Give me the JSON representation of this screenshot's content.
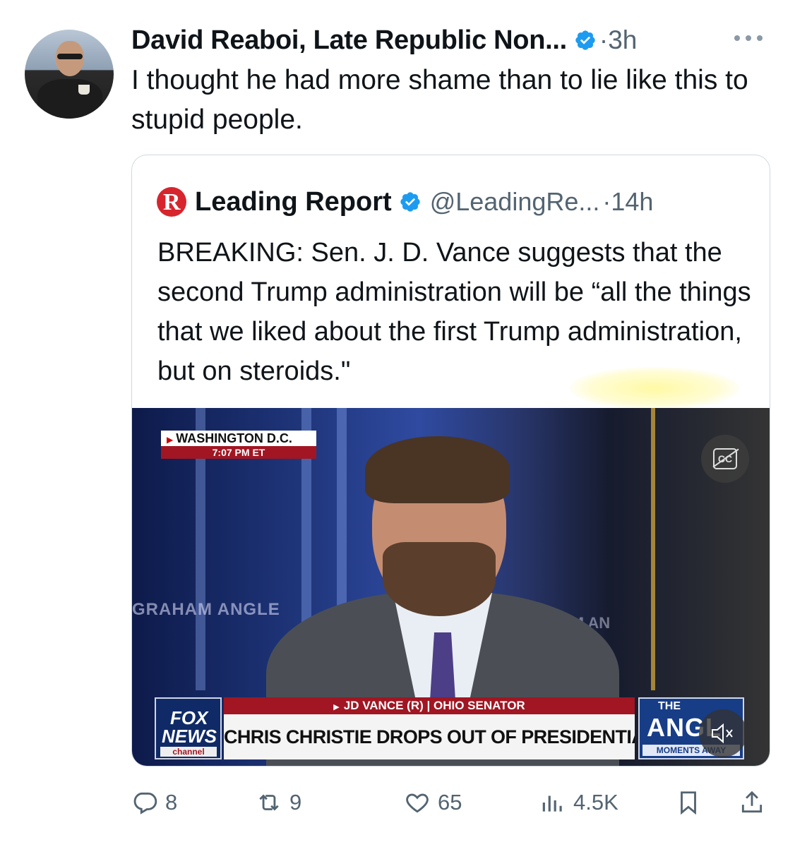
{
  "author": {
    "name": "David Reaboi, Late Republic Non...",
    "verified": true,
    "time": "·3h"
  },
  "tweet": {
    "text": "I thought he had more shame than to lie like this to stupid people."
  },
  "quote": {
    "account_name": "Leading Report",
    "handle": "@LeadingRe...",
    "time": "·14h",
    "logo_letter": "R",
    "text": "BREAKING: Sen. J. D. Vance suggests that the second Trump administration will be “all the things that we liked about the first Trump administration, but on steroids.\"",
    "video": {
      "location": "WASHINGTON D.C.",
      "broadcast_time": "7:07 PM ET",
      "background_text_left": "GRAHAM ANGLE",
      "background_text_right": "HAM AN",
      "lower_third_name": "JD VANCE (R) | OHIO SENATOR",
      "headline": "CHRIS CHRISTIE DROPS OUT OF PRESIDENTIAL RACE",
      "network_line1": "FOX",
      "network_line2": "NEWS",
      "network_line3": "channel",
      "show_the": "THE",
      "show_name": "ANGL",
      "show_tag": "MOMENTS AWAY",
      "cc_label": "CC"
    }
  },
  "actions": {
    "replies": "8",
    "reposts": "9",
    "likes": "65",
    "views": "4.5K"
  },
  "colors": {
    "verified_blue": "#1d9bf0",
    "secondary_text": "#536471",
    "fox_red": "#a11622",
    "leading_report_red": "#d7252e"
  },
  "icons": [
    "avatar",
    "verified-badge-icon",
    "more-icon",
    "cc-icon",
    "mute-icon",
    "reply-icon",
    "repost-icon",
    "like-icon",
    "views-icon",
    "bookmark-icon",
    "share-icon"
  ]
}
